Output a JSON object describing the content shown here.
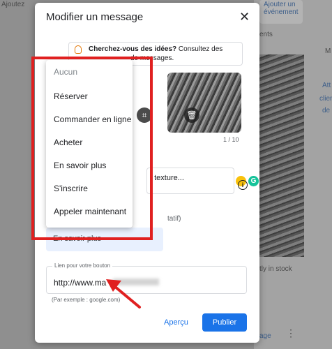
{
  "background": {
    "top_right_link": "Ajouter un",
    "top_right_link2": "événement",
    "left_top_text": "Ajoutez",
    "partial_text_1": "ents",
    "partial_text_2": "M",
    "partial_text_3": "Att",
    "partial_text_4": "clien",
    "partial_text_5": "de",
    "in_stock_text": "tly in stock",
    "bottom_link": "age"
  },
  "dialog": {
    "title": "Modifier un message",
    "close_icon": "close-icon",
    "tip": {
      "bold": "Cherchez-vous des idées?",
      "text": " Consultez des",
      "line2": "de messages."
    },
    "photo_counter": "1 / 10",
    "description_preview": "t texture...",
    "optional_label": "tatif)",
    "button_type_value": "En savoir plus",
    "link_field": {
      "label": "Lien pour votre bouton",
      "value": "http://www.ma",
      "hint": "(Par exemple : google.com)"
    },
    "preview_button": "Aperçu",
    "publish_button": "Publier"
  },
  "menu": {
    "items": [
      "Aucun",
      "Réserver",
      "Commander en ligne",
      "Acheter",
      "En savoir plus",
      "S'inscrire",
      "Appeler maintenant"
    ]
  },
  "colors": {
    "primary": "#1a73e8",
    "annotation": "#e02020",
    "selected_bg": "#e8f0fe"
  }
}
